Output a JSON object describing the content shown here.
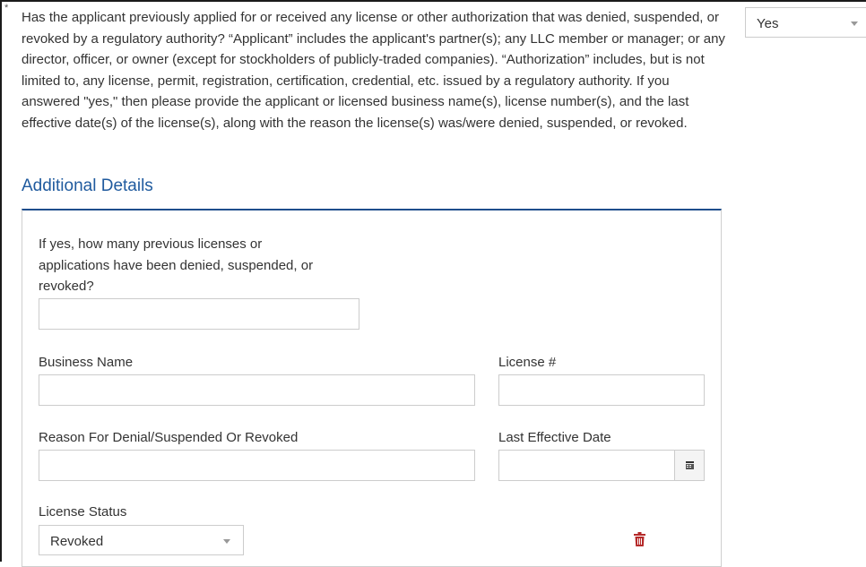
{
  "question": {
    "required_marker": "*",
    "text": "Has the applicant previously applied for or received any license or other authorization that was denied, suspended, or revoked by a regulatory authority? “Applicant” includes the applicant's partner(s); any LLC member or manager; or any director, officer, or owner (except for stockholders of publicly-traded companies). “Authorization” includes, but is not limited to, any license, permit, registration, certification, credential, etc. issued by a regulatory authority. If you answered \"yes,\" then please provide the applicant or licensed business name(s), license number(s), and the last effective date(s) of the license(s), along with the reason the license(s) was/were denied, suspended, or revoked.",
    "answer": "Yes"
  },
  "section": {
    "title": "Additional Details"
  },
  "form": {
    "count_label": "If yes, how many previous licenses or applications have been denied, suspended, or revoked?",
    "count_value": "",
    "business_name_label": "Business Name",
    "business_name_value": "",
    "license_number_label": "License #",
    "license_number_value": "",
    "reason_label": "Reason For Denial/Suspended Or Revoked",
    "reason_value": "",
    "last_effective_date_label": "Last Effective Date",
    "last_effective_date_value": "",
    "license_status_label": "License Status",
    "license_status_value": "Revoked"
  },
  "icons": {
    "dropdown": "chevron-down-icon",
    "calendar": "calendar-icon",
    "delete": "trash-icon"
  },
  "colors": {
    "section_title": "#1f5a9e",
    "panel_top_border": "#1f4e8c",
    "trash": "#b52a2a"
  }
}
